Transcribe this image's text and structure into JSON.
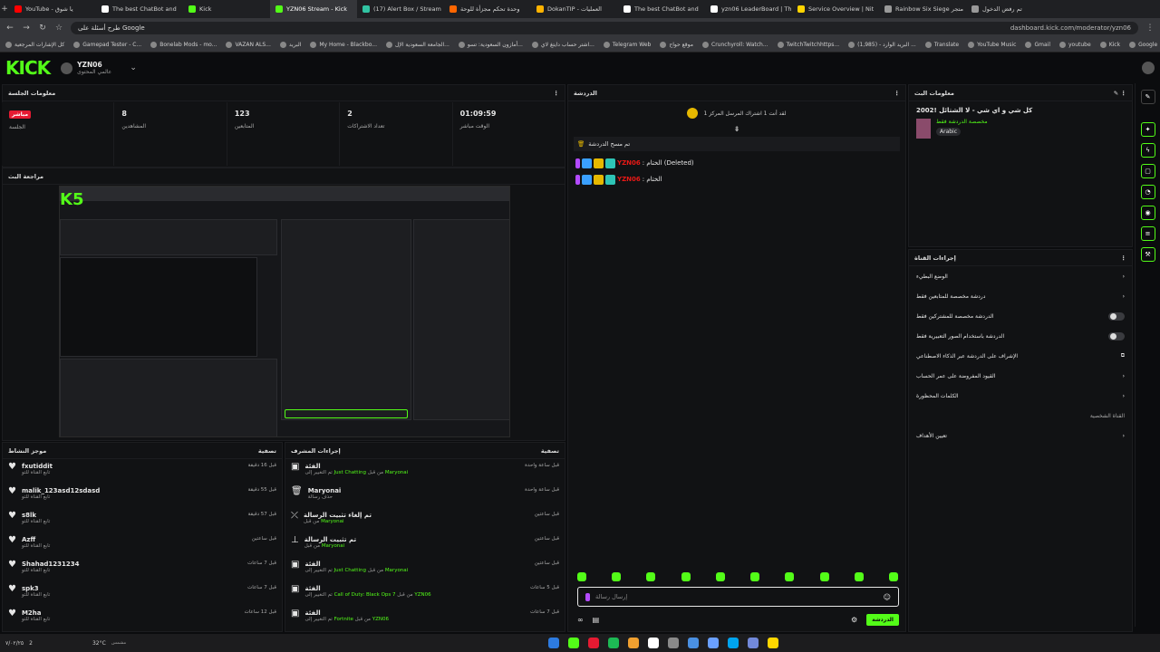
{
  "browser": {
    "tabs": [
      {
        "label": "YouTube - يا شوق",
        "color": "#ff0000",
        "active": false
      },
      {
        "label": "The best ChatBot and",
        "color": "#ffffff",
        "active": false
      },
      {
        "label": "Kick",
        "color": "#53fc18",
        "active": false
      },
      {
        "label": "YZN06 Stream - Kick",
        "color": "#53fc18",
        "active": true
      },
      {
        "label": "(17) Alert Box / Stream",
        "color": "#31c3a2",
        "active": false
      },
      {
        "label": "وحدة تحكم مجزأة للوحة",
        "color": "#ff6600",
        "active": false
      },
      {
        "label": "DokanTIP - العمليات",
        "color": "#ffb300",
        "active": false
      },
      {
        "label": "The best ChatBot and",
        "color": "#ffffff",
        "active": false
      },
      {
        "label": "yzn06 LeaderBoard | Th",
        "color": "#ffffff",
        "active": false
      },
      {
        "label": "Service Overview | Nit",
        "color": "#ffd400",
        "active": false
      },
      {
        "label": "Rainbow Six Siege متجر",
        "color": "#999999",
        "active": false
      },
      {
        "label": "تم رفض الدخول",
        "color": "#999999",
        "active": false
      }
    ],
    "search_hint": "طرح أسئلة على Google",
    "url": "dashboard.kick.com/moderator/yzn06",
    "bookmarks": [
      "كل الإشارات المرجعية",
      "Gamepad Tester - C...",
      "Bonelab Mods - mo...",
      "VAZAN ALS...",
      "البريد",
      "My Home - Blackbo...",
      "الجامعة السعودية الإل...",
      "أمازون السعودية: تسو...",
      "اشتر حساب دايتغ لاي...",
      "Telegram Web",
      "موقع حواح",
      "Crunchyroll: Watch...",
      "TwitchTwitchhttps...",
      "(1,985) - البريد الوارد ...",
      "Translate",
      "YouTube Music",
      "Gmail",
      "youtube",
      "Kick",
      "Google"
    ]
  },
  "header": {
    "logo": "KICK",
    "channel_name": "YZN06",
    "channel_sub": "عالمي المحتوى"
  },
  "session": {
    "title": "معلومات الجلسة",
    "stats": [
      {
        "value": "مباشر",
        "label": "الجلسة",
        "live": true
      },
      {
        "value": "8",
        "label": "المشاهدين",
        "live": false
      },
      {
        "value": "123",
        "label": "المتابعين",
        "live": false
      },
      {
        "value": "2",
        "label": "تعداد الاشتراكات",
        "live": false
      },
      {
        "value": "01:09:59",
        "label": "الوقت مباشر",
        "live": false
      }
    ]
  },
  "preview": {
    "title": "مراجعة البث"
  },
  "activity": {
    "title": "موجز النشاط",
    "filter": "تصفية",
    "items": [
      {
        "name": "fxutiddit",
        "sub": "تابع القناة للتو",
        "time": "قبل 16 دقيقة"
      },
      {
        "name": "malik_123asd12sdasd",
        "sub": "تابع القناة للتو",
        "time": "قبل 55 دقيقة"
      },
      {
        "name": "s8lk",
        "sub": "تابع القناة للتو",
        "time": "قبل 57 دقيقة"
      },
      {
        "name": "Azff",
        "sub": "تابع القناة للتو",
        "time": "قبل ساعتين"
      },
      {
        "name": "Shahad1231234",
        "sub": "تابع القناة للتو",
        "time": "قبل 7 ساعات"
      },
      {
        "name": "spk3",
        "sub": "تابع القناة للتو",
        "time": "قبل 7 ساعات"
      },
      {
        "name": "M2ha",
        "sub": "تابع القناة للتو",
        "time": "قبل 12 ساعات"
      }
    ]
  },
  "mod_actions": {
    "title": "إجراءات المشرف",
    "filter": "تصفية",
    "items": [
      {
        "title": "الفئة",
        "pre": "تم التغيير إلى ",
        "a": "Just Chatting",
        "mid": " من قبل ",
        "b": "Maryonai",
        "time": "قبل ساعة واحدة"
      },
      {
        "title": "Maryonai",
        "pre": "حذف رسالة",
        "a": "",
        "mid": "",
        "b": "",
        "time": "قبل ساعة واحدة"
      },
      {
        "title": "تم إلغاء تثبيت الرسالة",
        "pre": "من قبل ",
        "a": "Maryonai",
        "mid": "",
        "b": "",
        "time": "قبل ساعتين"
      },
      {
        "title": "تم تثبيت الرسالة",
        "pre": "من قبل ",
        "a": "Maryonai",
        "mid": "",
        "b": "",
        "time": "قبل ساعتين"
      },
      {
        "title": "الفئة",
        "pre": "تم التغيير إلى ",
        "a": "Just Chatting",
        "mid": " من قبل ",
        "b": "Maryonai",
        "time": "قبل ساعتين"
      },
      {
        "title": "الفئة",
        "pre": "تم التغيير إلى ",
        "a": "Call of Duty: Black Ops 7",
        "mid": " من قبل ",
        "b": "YZN06",
        "time": "قبل 5 ساعات"
      },
      {
        "title": "الفئة",
        "pre": "تم التغيير إلى ",
        "a": "Fortnite",
        "mid": " من قبل ",
        "b": "YZN06",
        "time": "قبل 7 ساعات"
      }
    ]
  },
  "chat": {
    "title": "الدردشة",
    "pinned": "لقد أنت 1 اشتراك المرسل المركز 1",
    "cleared": "تم مسح الدردشة",
    "messages": [
      {
        "user": "YZN06",
        "text": ": الختام (Deleted)"
      },
      {
        "user": "YZN06",
        "text": ": الختام"
      }
    ],
    "input_placeholder": "إرسال رسالة",
    "send_label": "الدردشة"
  },
  "stream_info": {
    "title": "معلومات البث",
    "stream_title": "كل شي و اي شي - لا الشتائل !2002",
    "category": "مخصصة الدردشة فقط",
    "language": "Arabic"
  },
  "channel_actions": {
    "title": "إجراءات القناة",
    "rows": [
      {
        "label": "الوضع البطيء",
        "control": "chevron"
      },
      {
        "label": "دردشة مخصصة للمتابعين فقط",
        "control": "chevron"
      },
      {
        "label": "الدردشة مخصصة للمشتركين فقط",
        "control": "toggle"
      },
      {
        "label": "الدردشة باستخدام الصور التعبيرية فقط",
        "control": "toggle"
      },
      {
        "label": "الإشراف على الدردشة عبر الذكاء الاصطناعي",
        "control": "external"
      },
      {
        "label": "القيود المفروضة على عمر الحساب",
        "control": "chevron"
      },
      {
        "label": "الكلمات المحظورة",
        "control": "chevron"
      },
      {
        "label": "القناة الشخصية",
        "control": "none"
      },
      {
        "label": "تعيين الأهداف",
        "control": "chevron"
      }
    ]
  },
  "taskbar": {
    "weather": "32°C",
    "weather_sub": "مشمس",
    "date": "٧/٠٢/٢٥",
    "time": "2"
  },
  "colors": {
    "accent": "#53fc18",
    "live": "#e51a32",
    "user": "#e91916"
  }
}
